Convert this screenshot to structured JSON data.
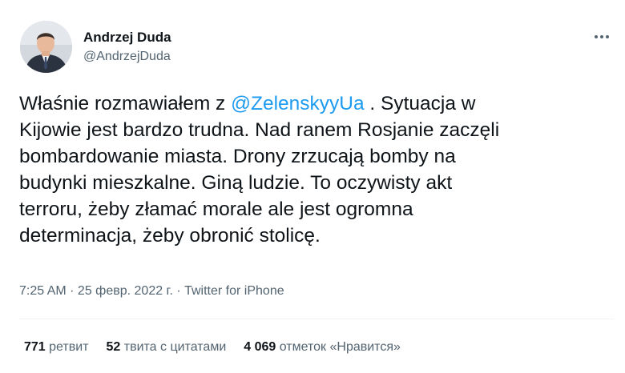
{
  "author": {
    "display_name": "Andrzej Duda",
    "handle": "@AndrzejDuda"
  },
  "tweet": {
    "line1_before": "Właśnie rozmawiałem z ",
    "mention": "@ZelenskyyUa",
    "line1_after": " . Sytuacja w",
    "rest": "Kijowie jest bardzo trudna. Nad ranem Rosjanie zaczęli\nbombardowanie miasta. Drony zrzucają bomby na\nbudynki mieszkalne. Giną ludzie. To oczywisty akt\nterroru, żeby złamać morale ale jest ogromna\ndeterminacja, żeby obronić stolicę."
  },
  "meta": {
    "time": "7:25 AM",
    "sep1": " · ",
    "date": "25 февр. 2022 г.",
    "sep2": " · ",
    "source": "Twitter for iPhone"
  },
  "stats": {
    "retweets_count": "771",
    "retweets_label": "ретвит",
    "quotes_count": "52",
    "quotes_label": "твита с цитатами",
    "likes_count": "4 069",
    "likes_label": "отметок «Нравится»"
  },
  "colors": {
    "text": "#0f1419",
    "secondary": "#536471",
    "accent": "#1d9bf0",
    "divider": "#eff3f4"
  },
  "icons": {
    "more": "more-horizontal-icon"
  }
}
